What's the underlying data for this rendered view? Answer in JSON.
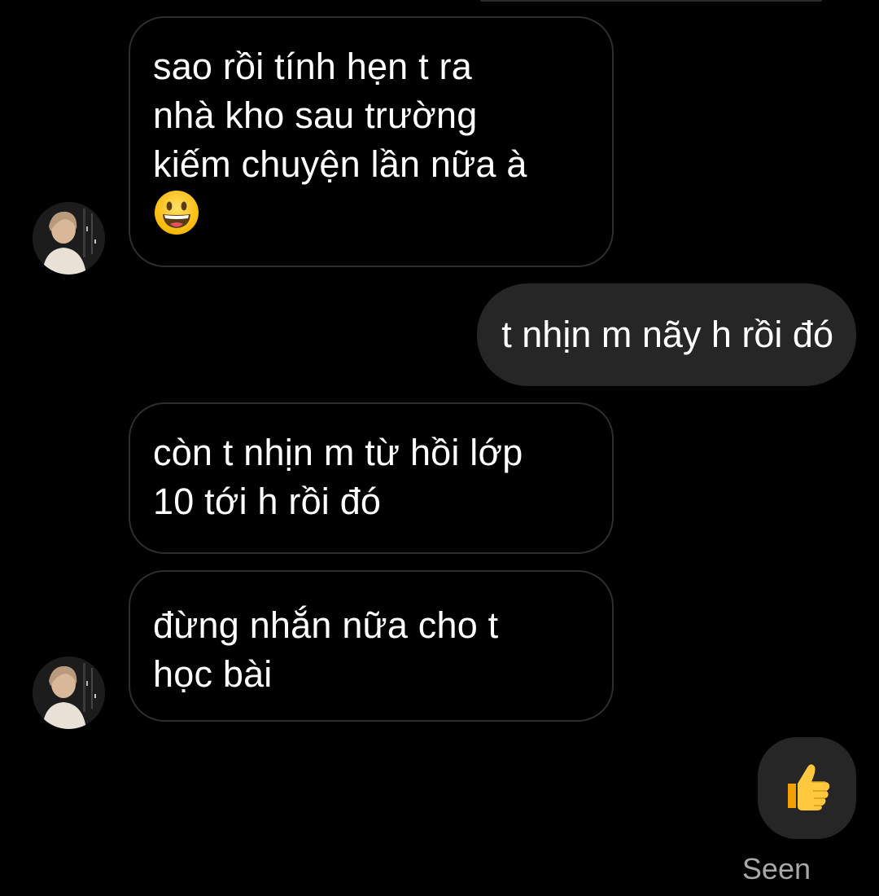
{
  "conversation": {
    "messages": [
      {
        "direction": "incoming",
        "text": "sao rồi tính hẹn t ra\nnhà kho sau trường\nkiếm chuyện lần nữa à",
        "emoji": "grinning-face"
      },
      {
        "direction": "outgoing",
        "text": "t nhịn m nãy h rồi đó"
      },
      {
        "direction": "incoming",
        "text": "còn t nhịn m từ hồi lớp\n10 tới h rồi đó"
      },
      {
        "direction": "incoming",
        "text": "đừng nhắn nữa cho t\nhọc bài"
      },
      {
        "direction": "outgoing",
        "emoji": "thumbs-up"
      }
    ],
    "status": "Seen"
  },
  "colors": {
    "background": "#000000",
    "incoming_border": "#2e2e2e",
    "outgoing_bubble": "#262626",
    "text": "#ffffff",
    "status_text": "#a8a8a8"
  }
}
